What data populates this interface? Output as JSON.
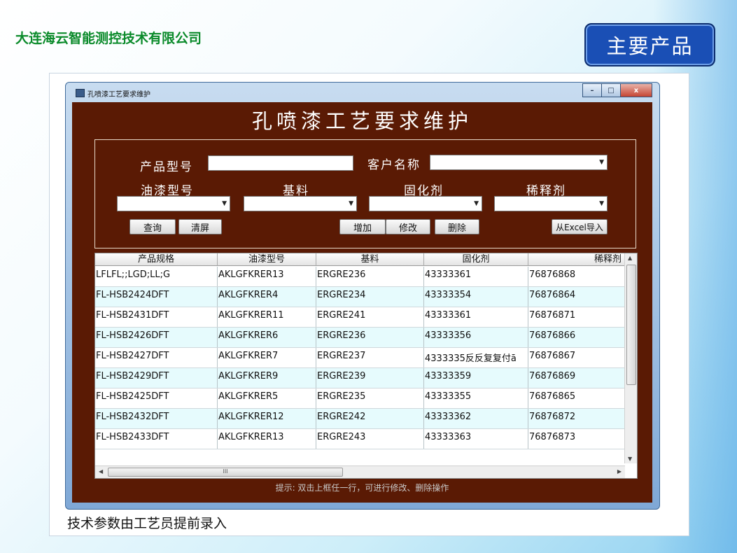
{
  "slide": {
    "company": "大连海云智能测控技术有限公司",
    "tag": "主要产品",
    "caption": "技术参数由工艺员提前录入"
  },
  "window": {
    "title": "孔喷漆工艺要求维护",
    "controls": [
      "–",
      "□",
      "x"
    ]
  },
  "app": {
    "heading": "孔喷漆工艺要求维护",
    "form": {
      "product_model_label": "产品型号",
      "product_model_value": "",
      "customer_label": "客户名称",
      "customer_value": "",
      "paint_model_label": "油漆型号",
      "base_label": "基料",
      "curing_label": "固化剂",
      "diluent_label": "稀释剂"
    },
    "buttons": {
      "query": "查询",
      "clear": "清屏",
      "add": "增加",
      "modify": "修改",
      "delete": "删除",
      "import_excel": "从Excel导入"
    },
    "hint": "提示: 双击上框任一行，可进行修改、删除操作"
  },
  "table": {
    "columns": [
      "产品规格",
      "油漆型号",
      "基料",
      "固化剂",
      "稀释剂"
    ],
    "rows": [
      [
        "LFLFL;;LGD;LL;G",
        "AKLGFKRER13",
        "ERGRE236",
        "43333361",
        "76876868"
      ],
      [
        "FL-HSB2424DFT",
        "AKLGFKRER4",
        "ERGRE234",
        "43333354",
        "76876864"
      ],
      [
        "FL-HSB2431DFT",
        "AKLGFKRER11",
        "ERGRE241",
        "43333361",
        "76876871"
      ],
      [
        "FL-HSB2426DFT",
        "AKLGFKRER6",
        "ERGRE236",
        "43333356",
        "76876866"
      ],
      [
        "FL-HSB2427DFT",
        "AKLGFKRER7",
        "ERGRE237",
        "4333335反反复复付ā",
        "76876867"
      ],
      [
        "FL-HSB2429DFT",
        "AKLGFKRER9",
        "ERGRE239",
        "43333359",
        "76876869"
      ],
      [
        "FL-HSB2425DFT",
        "AKLGFKRER5",
        "ERGRE235",
        "43333355",
        "76876865"
      ],
      [
        "FL-HSB2432DFT",
        "AKLGFKRER12",
        "ERGRE242",
        "43333362",
        "76876872"
      ],
      [
        "FL-HSB2433DFT",
        "AKLGFKRER13",
        "ERGRE243",
        "43333363",
        "76876873"
      ]
    ],
    "hscroll_thumb": "III"
  },
  "colors": {
    "client_bg": "#5a1a04",
    "company_text": "#0a8a2a",
    "tag_bg": "#1a4fb5",
    "alt_row": "#e6fbfd"
  }
}
